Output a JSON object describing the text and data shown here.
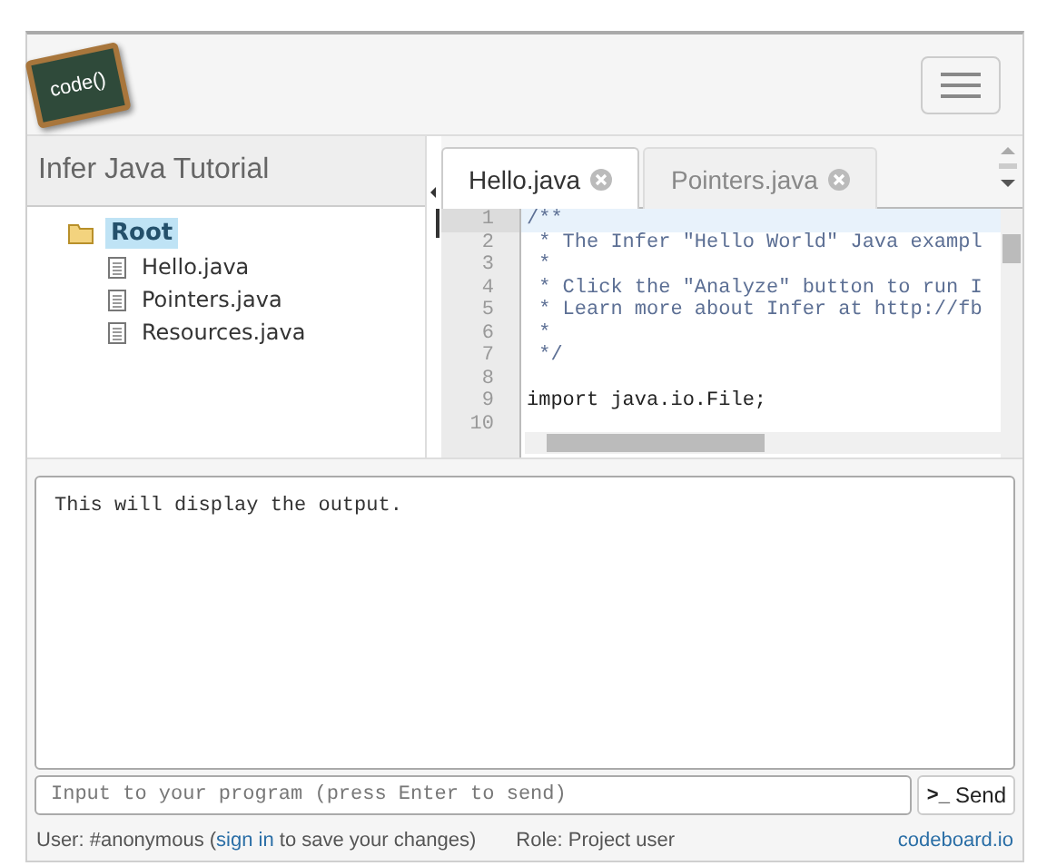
{
  "header": {
    "logo": "code()"
  },
  "project": {
    "title": "Infer Java Tutorial"
  },
  "tree": [
    {
      "label": "Root",
      "kind": "folder",
      "selected": true,
      "children": [
        {
          "label": "Hello.java",
          "kind": "file",
          "selected": false
        },
        {
          "label": "Pointers.java",
          "kind": "file",
          "selected": false
        },
        {
          "label": "Resources.java",
          "kind": "file",
          "selected": false
        }
      ]
    }
  ],
  "tabs": [
    {
      "label": "Hello.java",
      "selected": true
    },
    {
      "label": "Pointers.java",
      "selected": false
    }
  ],
  "code": [
    {
      "number": "1",
      "text": "/**",
      "kind": "comment",
      "selected": true
    },
    {
      "number": "2",
      "text": " * The Infer \"Hello World\" Java exampl",
      "kind": "comment",
      "selected": false
    },
    {
      "number": "3",
      "text": " *",
      "kind": "comment",
      "selected": false
    },
    {
      "number": "4",
      "text": " * Click the \"Analyze\" button to run I",
      "kind": "comment",
      "selected": false
    },
    {
      "number": "5",
      "text": " * Learn more about Infer at http://fb",
      "kind": "comment",
      "selected": false
    },
    {
      "number": "6",
      "text": " *",
      "kind": "comment",
      "selected": false
    },
    {
      "number": "7",
      "text": " */",
      "kind": "comment",
      "selected": false
    },
    {
      "number": "8",
      "kind": "code",
      "selected": false
    },
    {
      "number": "9",
      "text": "import java.io.File;",
      "kind": "code",
      "selected": false
    },
    {
      "number": "10",
      "kind": "code",
      "selected": false
    }
  ],
  "output": {
    "text": "This will display the output."
  },
  "input": {
    "placeholder": "Input to your program (press Enter to send)"
  },
  "send_button": {
    "icon": ">_",
    "label": "Send"
  },
  "status_bar": {
    "user": "User: #anonymous (",
    "link": "sign in",
    "after": " to save your changes)",
    "role": "Role: Project user",
    "brand": "codeboard.io"
  }
}
